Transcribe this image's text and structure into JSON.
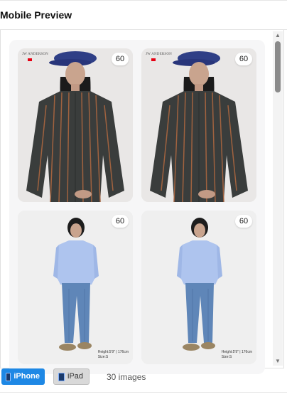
{
  "header": {
    "title": "Mobile Preview"
  },
  "cards": [
    {
      "count": "60",
      "brand": "JW ANDERSON",
      "caption_line1": "",
      "caption_line2": ""
    },
    {
      "count": "60",
      "brand": "JW ANDERSON",
      "caption_line1": "",
      "caption_line2": ""
    },
    {
      "count": "60",
      "brand": "",
      "caption_line1": "Height:5'9\" | 176cm",
      "caption_line2": "Size:S"
    },
    {
      "count": "60",
      "brand": "",
      "caption_line1": "Height:5'9\" | 176cm",
      "caption_line2": "Size:S"
    }
  ],
  "devices": {
    "iphone_label": "iPhone",
    "ipad_label": "iPad",
    "iphone_icon": "phone-icon",
    "ipad_icon": "tablet-icon",
    "active_color": "#1e88e5"
  },
  "status": {
    "image_count": "30 images"
  }
}
